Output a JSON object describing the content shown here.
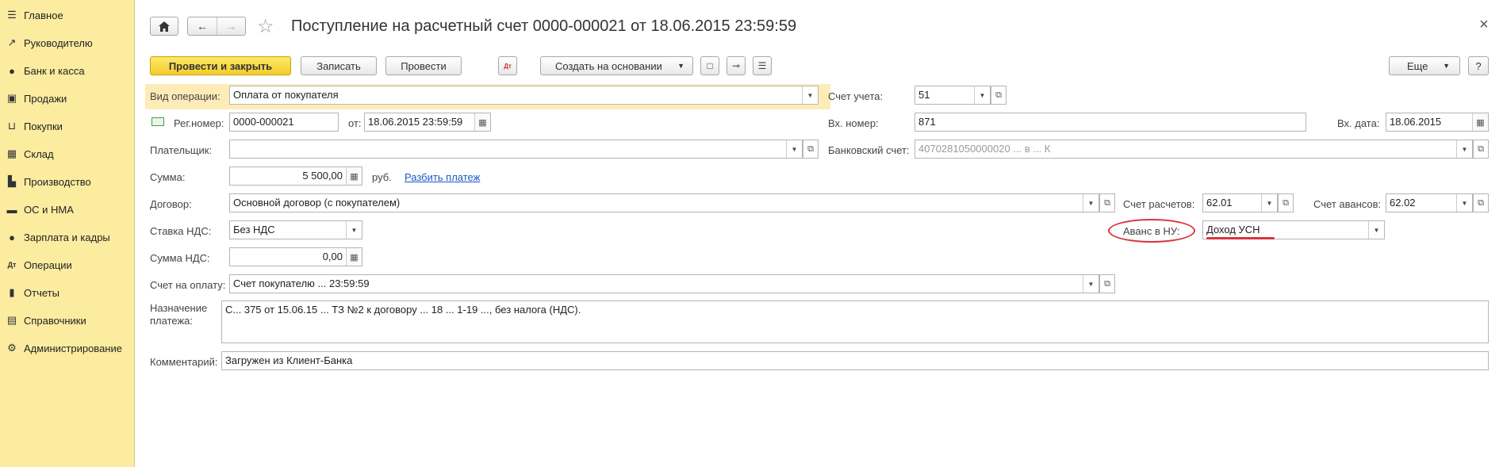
{
  "sidebar": {
    "items": [
      {
        "label": "Главное",
        "icon": "menu-icon",
        "glyph": "☰"
      },
      {
        "label": "Руководителю",
        "icon": "trend-icon",
        "glyph": "↗"
      },
      {
        "label": "Банк и касса",
        "icon": "coin-icon",
        "glyph": "●"
      },
      {
        "label": "Продажи",
        "icon": "bag-icon",
        "glyph": "▣"
      },
      {
        "label": "Покупки",
        "icon": "cart-icon",
        "glyph": "⊔"
      },
      {
        "label": "Склад",
        "icon": "warehouse-icon",
        "glyph": "▦"
      },
      {
        "label": "Производство",
        "icon": "factory-icon",
        "glyph": "▙"
      },
      {
        "label": "ОС и НМА",
        "icon": "truck-icon",
        "glyph": "▬"
      },
      {
        "label": "Зарплата и кадры",
        "icon": "person-icon",
        "glyph": "●"
      },
      {
        "label": "Операции",
        "icon": "operations-icon",
        "glyph": "Дт"
      },
      {
        "label": "Отчеты",
        "icon": "bar-chart-icon",
        "glyph": "▮"
      },
      {
        "label": "Справочники",
        "icon": "book-icon",
        "glyph": "▤"
      },
      {
        "label": "Администрирование",
        "icon": "gear-icon",
        "glyph": "⚙"
      }
    ]
  },
  "header": {
    "title": "Поступление на расчетный счет 0000-000021 от 18.06.2015 23:59:59",
    "close_glyph": "×"
  },
  "toolbar": {
    "post_close": "Провести и закрыть",
    "save": "Записать",
    "post": "Провести",
    "create_based": "Создать на основании",
    "more": "Еще",
    "help": "?"
  },
  "form": {
    "op_type_label": "Вид операции:",
    "op_type_value": "Оплата от покупателя",
    "account_label": "Счет учета:",
    "account_value": "51",
    "reg_label": "Рег.номер:",
    "reg_value": "0000-000021",
    "from_label": "от:",
    "from_value": "18.06.2015 23:59:59",
    "in_num_label": "Вх. номер:",
    "in_num_value": "871",
    "in_date_label": "Вх. дата:",
    "in_date_value": "18.06.2015",
    "payer_label": "Плательщик:",
    "payer_value": "",
    "bank_acc_label": "Банковский счет:",
    "bank_acc_value": "4070281050000020 ... в ... К",
    "sum_label": "Сумма:",
    "sum_value": "5 500,00",
    "currency": "руб.",
    "split_link": "Разбить платеж",
    "contract_label": "Договор:",
    "contract_value": "Основной договор (с покупателем)",
    "settle_acc_label": "Счет расчетов:",
    "settle_acc_value": "62.01",
    "advance_acc_label": "Счет авансов:",
    "advance_acc_value": "62.02",
    "vat_rate_label": "Ставка НДС:",
    "vat_rate_value": "Без НДС",
    "advance_nu_label": "Аванс в НУ:",
    "advance_nu_value": "Доход УСН",
    "vat_sum_label": "Сумма НДС:",
    "vat_sum_value": "0,00",
    "invoice_label": "Счет на оплату:",
    "invoice_value": "Счет покупателю ... 23:59:59",
    "purpose_label_1": "Назначение",
    "purpose_label_2": "платежа:",
    "purpose_value": "С... 375 от 15.06.15 ... ТЗ №2 к договору ... 18 ... 1-19 ..., без налога (НДС).",
    "comment_label": "Комментарий:",
    "comment_value": "Загружен из Клиент-Банка"
  },
  "colors": {
    "sidebar_bg": "#fbeca0",
    "highlight_bg": "#fdecb8",
    "annotation_red": "#d9343f"
  }
}
